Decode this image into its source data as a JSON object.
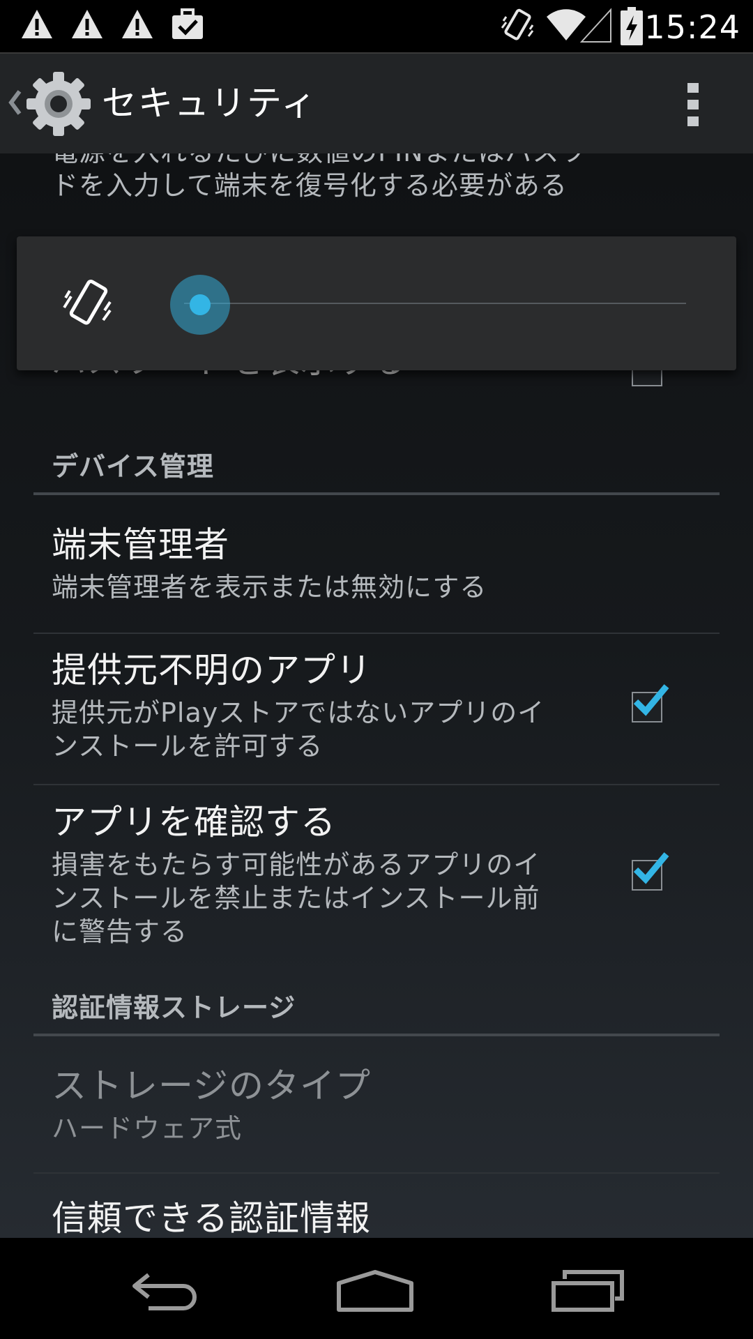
{
  "status_bar": {
    "time": "15:24",
    "left_icons": [
      "warning-icon",
      "warning-icon",
      "warning-icon",
      "briefcase-check-icon"
    ],
    "right_icons": [
      "vibrate-icon",
      "wifi-icon",
      "signal-icon",
      "battery-charging-icon"
    ]
  },
  "action_bar": {
    "title": "セキュリティ",
    "up_icon": "chevron-left-icon",
    "app_icon": "gear-icon",
    "overflow_icon": "overflow-menu-icon"
  },
  "content": {
    "top_partial_summary": [
      "電源を入れるたびに数値のPINまたはパスワー",
      "ドを入力して端末を復号化する必要がある"
    ],
    "partial_title_behind_popup": "パスワードを表示する",
    "volume_popup": {
      "icon": "vibrate-icon",
      "level": 0
    },
    "sections": {
      "device_admin": "デバイス管理",
      "credential_storage": "認証情報ストレージ"
    },
    "prefs": {
      "device_admins": {
        "title": "端末管理者",
        "summary": "端末管理者を表示または無効にする"
      },
      "unknown_sources": {
        "title": "提供元不明のアプリ",
        "summary_lines": [
          "提供元がPlayストアではないアプリのイ",
          "ンストールを許可する"
        ],
        "checked": true
      },
      "verify_apps": {
        "title": "アプリを確認する",
        "summary_lines": [
          "損害をもたらす可能性があるアプリのイ",
          "ンストールを禁止またはインストール前",
          "に警告する"
        ],
        "checked": true
      },
      "storage_type": {
        "title": "ストレージのタイプ",
        "summary": "ハードウェア式",
        "enabled": false
      },
      "trusted_credentials": {
        "title": "信頼できる認証情報"
      }
    },
    "accent_color": "#33b5e5"
  },
  "nav_bar": {
    "buttons": [
      "back-icon",
      "home-icon",
      "recents-icon"
    ]
  }
}
